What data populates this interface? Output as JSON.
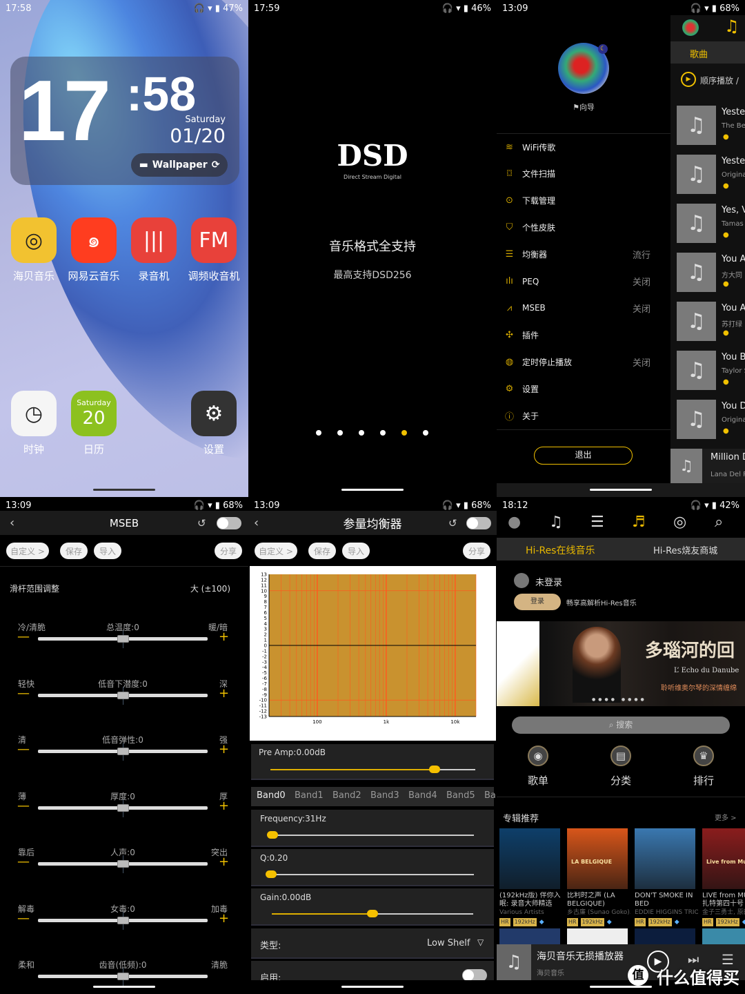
{
  "colors": {
    "accent": "#f0c000",
    "peq_plot": "#c9922f",
    "peq_grid": "#ff5a1f",
    "hires_gold": "#d4b483"
  },
  "home": {
    "status": {
      "time": "17:58",
      "battery": "47%"
    },
    "clock": {
      "hour": "17",
      "minute": ":58",
      "weekday": "Saturday",
      "date": "01/20",
      "wallpaper_label": "Wallpaper"
    },
    "apps": [
      {
        "label": "海贝音乐",
        "icon": "hiby-disc-icon",
        "color": "#f2c230"
      },
      {
        "label": "网易云音乐",
        "icon": "netease-icon",
        "color": "#ff3d1f"
      },
      {
        "label": "录音机",
        "icon": "waveform-icon",
        "color": "#e8413a"
      },
      {
        "label": "调频收音机",
        "icon": "fm-radio-icon",
        "color": "#e8413a"
      },
      {
        "label": "时钟",
        "icon": "clock-icon",
        "color": "#f5f5f5"
      },
      {
        "label": "日历",
        "icon": "calendar-icon",
        "color": "#8cc11f",
        "day": "Saturday",
        "date": "20"
      },
      {
        "label": "设置",
        "icon": "gear-icon",
        "color": "#333333"
      }
    ]
  },
  "splash": {
    "status": {
      "time": "17:59",
      "battery": "46%"
    },
    "logo": "DSD",
    "logo_sub": "Direct Stream Digital",
    "title": "音乐格式全支持",
    "subtitle": "最高支持DSD256",
    "page_count": 6,
    "active_page": 5
  },
  "drawer": {
    "status": {
      "time": "13:09",
      "battery": "68%"
    },
    "guide": "向导",
    "items": [
      {
        "label": "WiFi传歌",
        "icon": "wifi-icon",
        "value": ""
      },
      {
        "label": "文件扫描",
        "icon": "scan-icon",
        "value": ""
      },
      {
        "label": "下载管理",
        "icon": "download-icon",
        "value": ""
      },
      {
        "label": "个性皮肤",
        "icon": "shirt-icon",
        "value": ""
      },
      {
        "label": "均衡器",
        "icon": "equalizer-icon",
        "value": "流行"
      },
      {
        "label": "PEQ",
        "icon": "peq-icon",
        "value": "关闭"
      },
      {
        "label": "MSEB",
        "icon": "mseb-icon",
        "value": "关闭"
      },
      {
        "label": "插件",
        "icon": "plugin-icon",
        "value": ""
      },
      {
        "label": "定时停止播放",
        "icon": "timer-icon",
        "value": "关闭"
      },
      {
        "label": "设置",
        "icon": "gear-icon",
        "value": ""
      },
      {
        "label": "关于",
        "icon": "info-icon",
        "value": ""
      }
    ],
    "exit_label": "退出",
    "behind": {
      "tab": "歌曲",
      "play_mode": "顺序播放 /",
      "songs": [
        {
          "title": "Yester",
          "artist": "The Bea"
        },
        {
          "title": "Yester",
          "artist": "Original"
        },
        {
          "title": "Yes, V",
          "artist": "Tamas"
        },
        {
          "title": "You A",
          "artist": "方大同"
        },
        {
          "title": "You A",
          "artist": "苏打绿"
        },
        {
          "title": "You B",
          "artist": "Taylor S"
        },
        {
          "title": "You D",
          "artist": "Original"
        }
      ],
      "now_playing": {
        "title": "Million D",
        "artist": "Lana Del Re"
      }
    }
  },
  "mseb": {
    "status": {
      "time": "13:09",
      "battery": "68%"
    },
    "title": "MSEB",
    "buttons": {
      "custom": "自定义 >",
      "save": "保存",
      "import": "导入",
      "share": "分享"
    },
    "range_label": "滑杆范围调整",
    "range_value": "大 (±100)",
    "sliders": [
      {
        "left": "冷/清脆",
        "name": "总温度:0",
        "right": "暖/暗",
        "value": 0
      },
      {
        "left": "轻快",
        "name": "低音下潜度:0",
        "right": "深",
        "value": 0
      },
      {
        "left": "清",
        "name": "低音弹性:0",
        "right": "强",
        "value": 0
      },
      {
        "left": "薄",
        "name": "厚度:0",
        "right": "厚",
        "value": 0
      },
      {
        "left": "靠后",
        "name": "人声:0",
        "right": "突出",
        "value": 0
      },
      {
        "left": "解毒",
        "name": "女毒:0",
        "right": "加毒",
        "value": 0
      },
      {
        "left": "柔和",
        "name": "齿音(低频):0",
        "right": "清脆",
        "value": 0
      }
    ]
  },
  "peq": {
    "status": {
      "time": "13:09",
      "battery": "68%"
    },
    "title": "参量均衡器",
    "buttons": {
      "custom": "自定义 >",
      "save": "保存",
      "import": "导入",
      "share": "分享"
    },
    "preamp": "Pre Amp:0.00dB",
    "preamp_fraction": 0.8,
    "bands": [
      "Band0",
      "Band1",
      "Band2",
      "Band3",
      "Band4",
      "Band5",
      "Ba"
    ],
    "frequency": "Frequency:31Hz",
    "frequency_fraction": 0.0,
    "q": "Q:0.20",
    "q_fraction": 0.0,
    "gain": "Gain:0.00dB",
    "gain_fraction": 0.5,
    "type_label": "类型:",
    "type_value": "Low Shelf",
    "enable_label": "启用:"
  },
  "chart_data": {
    "type": "line",
    "xscale": "log",
    "xlim": [
      20,
      20000
    ],
    "ylim": [
      -13,
      13
    ],
    "xticks": [
      "100",
      "1k",
      "10k"
    ],
    "yticks": [
      13,
      12,
      11,
      10,
      9,
      8,
      7,
      6,
      5,
      4,
      3,
      2,
      1,
      0,
      -1,
      -2,
      -3,
      -4,
      -5,
      -6,
      -7,
      -8,
      -9,
      -10,
      -11,
      -12,
      -13
    ],
    "x": [
      20,
      100,
      1000,
      10000,
      20000
    ],
    "y": [
      0,
      0,
      0,
      0,
      0
    ],
    "grid": true
  },
  "hires": {
    "status": {
      "time": "18:12",
      "battery": "42%"
    },
    "nav_icons": [
      "user-icon",
      "music-note-icon",
      "playlist-icon",
      "hires-note-icon",
      "disc-icon",
      "search-icon"
    ],
    "tabs": [
      "Hi-Res在线音乐",
      "Hi-Res烧友商城"
    ],
    "user": "未登录",
    "login": "登录",
    "login_hint": "畅享高解析Hi-Res音乐",
    "banner": {
      "title": "多瑙河的回",
      "sub": "L’ Echo du Danube",
      "tagline": "聆听维奥尔琴的深情缠绵"
    },
    "search": "搜索",
    "categories": [
      "歌单",
      "分类",
      "排行"
    ],
    "section": "专辑推荐",
    "more": "更多 >",
    "albums": [
      {
        "title": "(192kHz版) 伴你入眠: 录音大师精选",
        "artist": "Various Artists",
        "badge": "192kHz",
        "cover": "#0e3f6a"
      },
      {
        "title": "比利时之声 (LA BELGIQUE)",
        "artist": "乡古廉 (Sunao Goko)...",
        "badge": "192kHz",
        "cover": "#d8561a",
        "cover_text": "LA BELGIQUE"
      },
      {
        "title": "DON'T SMOKE IN BED",
        "artist": "EDDIE HIGGINS TRIO",
        "badge": "192kHz",
        "cover": "#3a78b0"
      },
      {
        "title": "LIVE from MUZ 莫扎特第四十号",
        "artist": "金子三勇士, 原田",
        "badge": "192kHz",
        "cover": "#8a1d1d",
        "cover_text": "Live from Muza!"
      }
    ],
    "player": {
      "title": "海贝音乐无损播放器",
      "artist": "海贝音乐"
    },
    "watermark": "什么值得买",
    "watermark_badge": "值"
  }
}
